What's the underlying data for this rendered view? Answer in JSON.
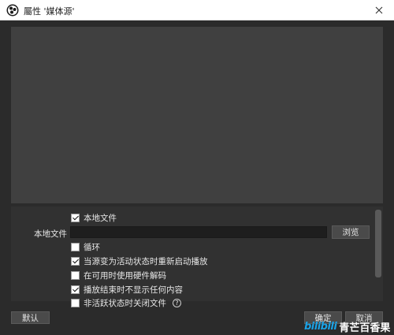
{
  "window": {
    "title": "屬性 '媒体源'",
    "icon": "obs-logo-icon",
    "close_icon": "close-icon"
  },
  "properties": {
    "local_file_checkbox": {
      "label": "本地文件",
      "checked": true
    },
    "local_file_field": {
      "label": "本地文件",
      "value": ""
    },
    "browse_button": "浏览",
    "loop": {
      "label": "循环",
      "checked": false
    },
    "restart_on_active": {
      "label": "当源变为活动状态时重新启动播放",
      "checked": true
    },
    "hw_decode": {
      "label": "在可用时使用硬件解码",
      "checked": false
    },
    "hide_on_end": {
      "label": "播放结束时不显示任何内容",
      "checked": true
    },
    "close_when_inactive": {
      "label": "非活跃状态时关闭文件",
      "checked": false
    }
  },
  "footer": {
    "defaults_button": "默认",
    "ok_button": "确定",
    "cancel_button": "取消"
  },
  "watermark": {
    "logo": "bilibili",
    "text": "青芒百香果"
  },
  "colors": {
    "accent": "#1aa2e6",
    "background": "#2b2b2b",
    "preview": "#404040"
  }
}
